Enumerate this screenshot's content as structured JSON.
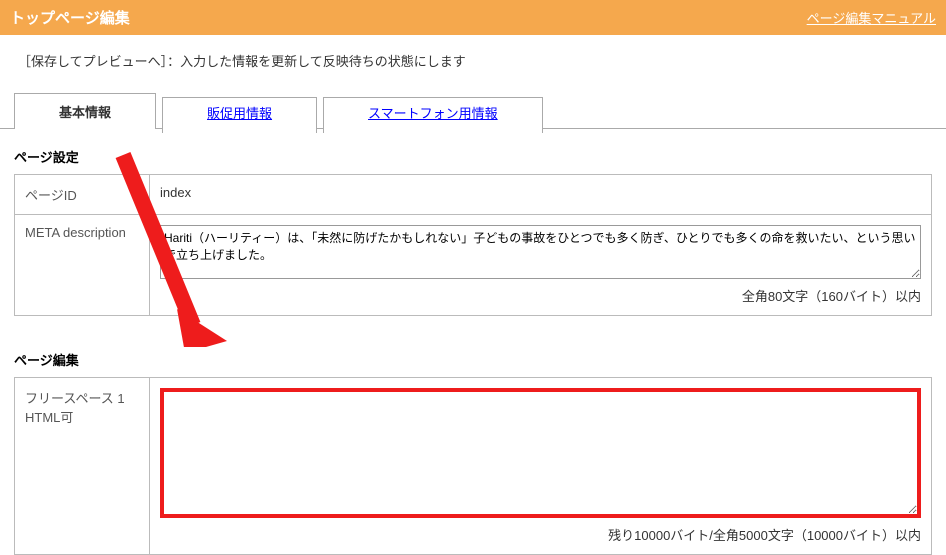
{
  "header": {
    "title": "トップページ編集",
    "manual_link": "ページ編集マニュアル"
  },
  "instruction": "［保存してプレビューへ］：入力した情報を更新して反映待ちの状態にします",
  "tabs": {
    "basic": "基本情報",
    "promo": "販促用情報",
    "smartphone": "スマートフォン用情報"
  },
  "page_settings": {
    "section_title": "ページ設定",
    "page_id_label": "ページID",
    "page_id_value": "index",
    "meta_desc_label": "META description",
    "meta_desc_value": "Hariti（ハーリティー）は、「未然に防げたかもしれない」子どもの事故をひとつでも多く防ぎ、ひとりでも多くの命を救いたい、という思いで立ち上げました。",
    "meta_desc_limit": "全角80文字（160バイト）以内"
  },
  "page_edit": {
    "section_title": "ページ編集",
    "freespace_label_line1": "フリースペース 1",
    "freespace_label_line2": "HTML可",
    "freespace_value": "",
    "freespace_limit": "残り10000バイト/全角5000文字（10000バイト）以内"
  }
}
